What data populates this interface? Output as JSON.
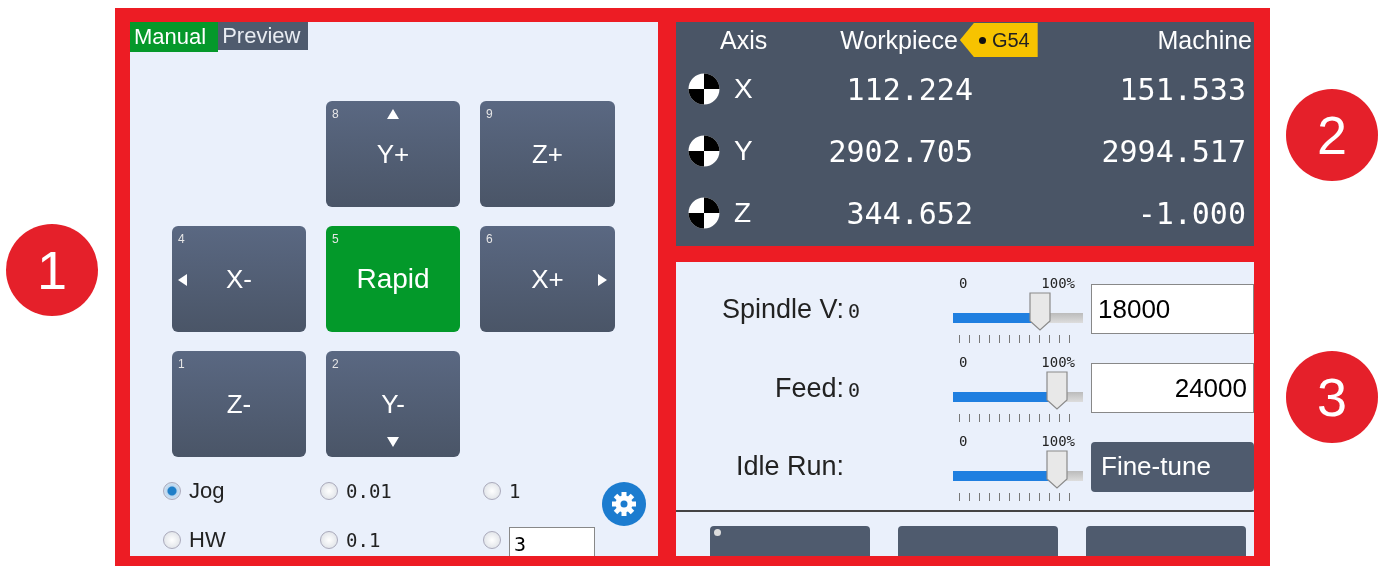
{
  "left_callouts": [
    {
      "label": "1"
    }
  ],
  "right_callouts": [
    {
      "label": "2"
    },
    {
      "label": "3"
    }
  ],
  "jog_panel": {
    "tabs": [
      {
        "label": "Manual",
        "selected": true
      },
      {
        "label": "Preview",
        "selected": false
      }
    ],
    "keys": [
      {
        "kind": "empty"
      },
      {
        "kind": "up",
        "number": "8",
        "label": "Y+",
        "active": false
      },
      {
        "kind": "plain",
        "number": "9",
        "label": "Z+",
        "active": false
      },
      {
        "kind": "left",
        "number": "4",
        "label": "X-",
        "active": false
      },
      {
        "kind": "plain",
        "number": "5",
        "label": "Rapid",
        "active": true
      },
      {
        "kind": "right",
        "number": "6",
        "label": "X+",
        "active": false
      },
      {
        "kind": "plain",
        "number": "1",
        "label": "Z-",
        "active": false
      },
      {
        "kind": "down",
        "number": "2",
        "label": "Y-",
        "active": false
      }
    ],
    "modes": [
      {
        "label": "Jog",
        "selected": true
      },
      {
        "label": "HW",
        "selected": false
      }
    ],
    "steps": [
      {
        "kind": "preset",
        "label": "0.01",
        "selected": false
      },
      {
        "kind": "preset",
        "label": "0.1",
        "selected": false
      },
      {
        "kind": "preset",
        "label": "1",
        "selected": false
      },
      {
        "kind": "custom",
        "value": "3",
        "selected": false
      }
    ]
  },
  "coordinates": {
    "header": {
      "axis": "Axis",
      "workpiece": "Workpiece",
      "coordinate_system": "G54",
      "machine": "Machine"
    },
    "rows": [
      {
        "axis": "X",
        "workpiece": "112.224",
        "machine": "151.533"
      },
      {
        "axis": "Y",
        "workpiece": "2902.705",
        "machine": "2994.517"
      },
      {
        "axis": "Z",
        "workpiece": "344.652",
        "machine": "-1.000"
      }
    ]
  },
  "overrides": [
    {
      "label": "Spindle V:",
      "value": "0",
      "scale_min": "0",
      "scale_max": "100%",
      "level": 0.67,
      "control": {
        "kind": "field",
        "value": "18000",
        "right_aligned": false
      }
    },
    {
      "label": "Feed:",
      "value": "0",
      "scale_min": "0",
      "scale_max": "100%",
      "level": 0.8,
      "control": {
        "kind": "field",
        "value": "24000",
        "right_aligned": true
      }
    },
    {
      "label": "Idle Run:",
      "scale_min": "0",
      "scale_max": "100%",
      "level": 0.8,
      "control": {
        "kind": "button",
        "label": "Fine-tune"
      }
    }
  ]
}
